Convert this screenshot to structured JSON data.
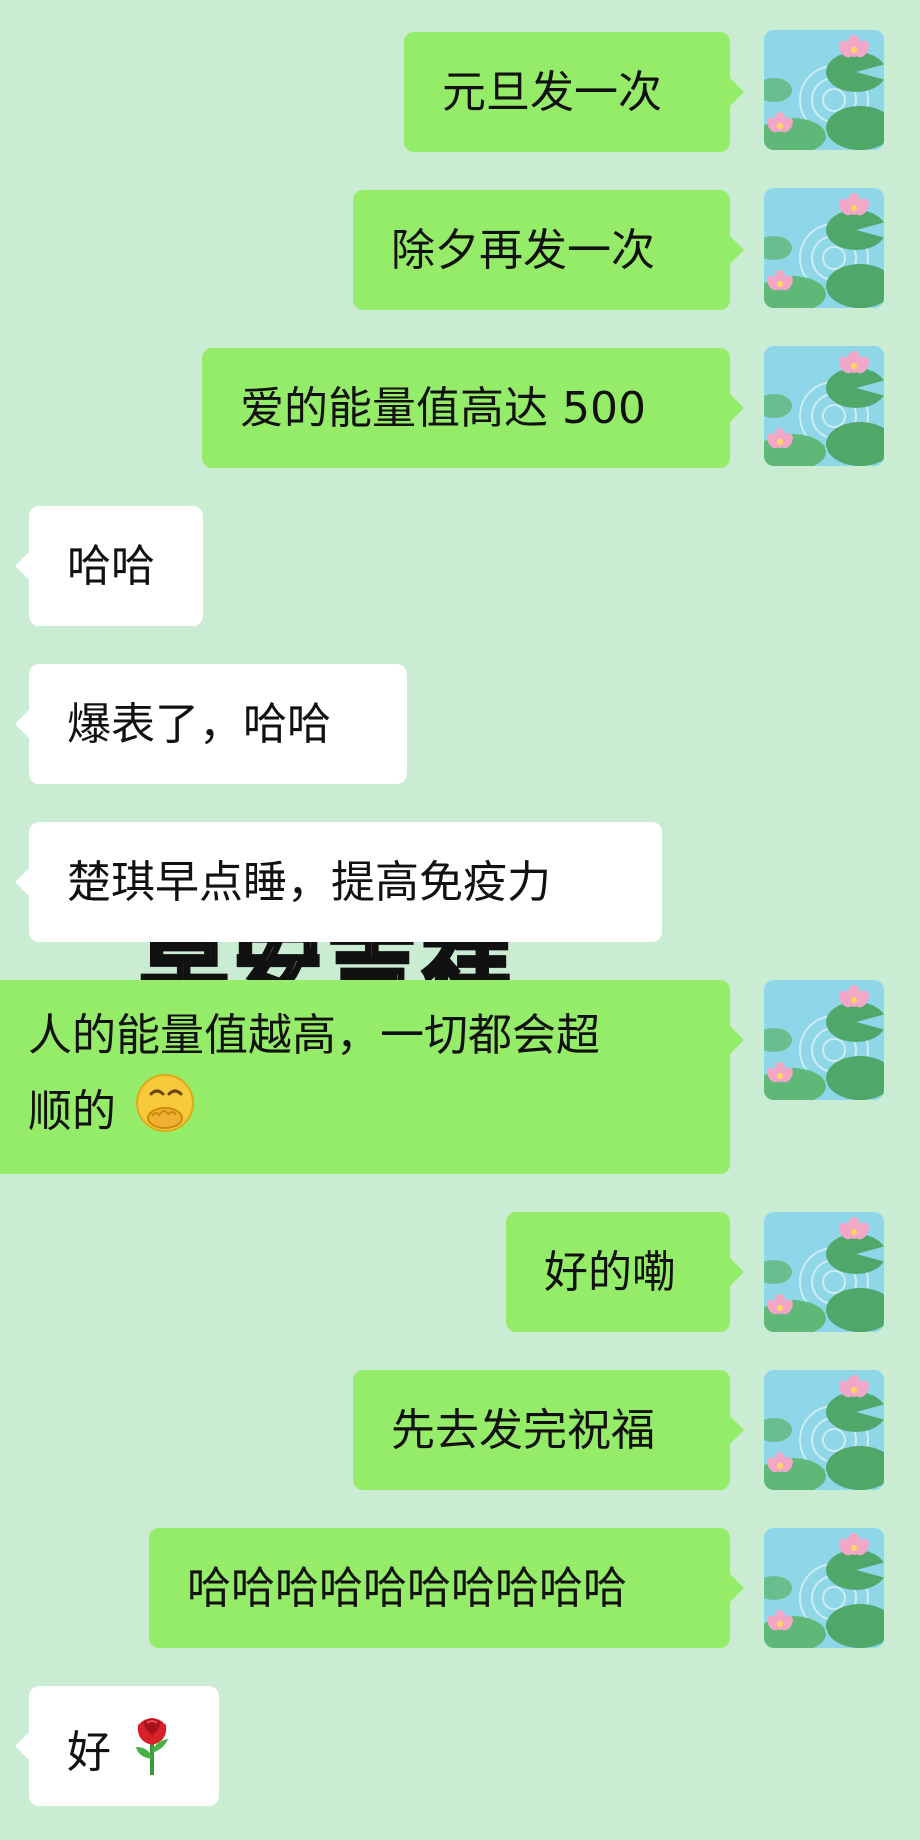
{
  "messages": [
    {
      "side": "out",
      "text": "元旦发一次"
    },
    {
      "side": "out",
      "text": "除夕再发一次"
    },
    {
      "side": "out",
      "text": "爱的能量值高达 500"
    },
    {
      "side": "in",
      "text": "哈哈"
    },
    {
      "side": "in",
      "text": "爆表了，哈哈"
    },
    {
      "side": "in",
      "text": "楚琪早点睡，提高免疫力"
    },
    {
      "side": "out",
      "line1": "人的能量值越高，一切都会超",
      "line2": "顺的",
      "emoji": "face-with-hand-over-mouth"
    },
    {
      "side": "out",
      "text": "好的嘞"
    },
    {
      "side": "out",
      "text": "先去发完祝福"
    },
    {
      "side": "out",
      "text": "哈哈哈哈哈哈哈哈哈哈"
    },
    {
      "side": "in",
      "text": "好",
      "emoji": "rose"
    }
  ],
  "avatar": {
    "icon": "lotus-pond-avatar",
    "colors": {
      "water": "#8fd6e8",
      "lily_pad": "#4fa86a",
      "lotus": "#f3a7c6"
    }
  },
  "background_overlay_text": "早安吉祥",
  "colors": {
    "background": "#c9ecd3",
    "outgoing_bubble": "#95ec69",
    "incoming_bubble": "#ffffff"
  }
}
